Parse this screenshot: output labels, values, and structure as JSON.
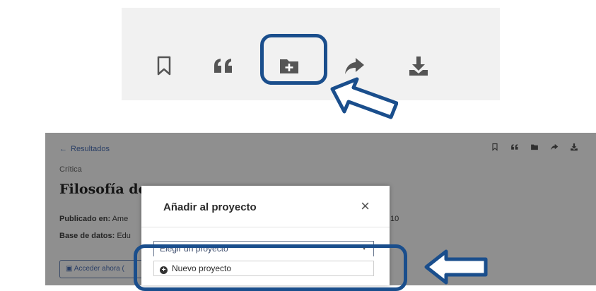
{
  "toolbar_zoom": {
    "icons": [
      "bookmark-icon",
      "quote-icon",
      "folder-add-icon",
      "share-icon",
      "download-icon"
    ],
    "highlighted_icon": "folder-add-icon"
  },
  "page": {
    "back_label": "Resultados",
    "breadcrumb": "Crítica",
    "title": "Filosofía de",
    "published_label": "Publicado en:",
    "published_value": "Ame",
    "year_fragment": "10",
    "database_label": "Base de datos:",
    "database_value": "Edu",
    "access_button": "Acceder ahora (",
    "mini_toolbar_icons": [
      "bookmark-icon",
      "quote-icon",
      "folder-add-icon",
      "share-icon",
      "download-icon"
    ]
  },
  "modal": {
    "title": "Añadir al proyecto",
    "select_placeholder": "Elegir un proyecto",
    "new_project_label": "Nuevo proyecto"
  },
  "colors": {
    "highlight": "#1a4e8c",
    "panel_bg": "#f1f1f1",
    "overlay": "#8f8f8f"
  }
}
